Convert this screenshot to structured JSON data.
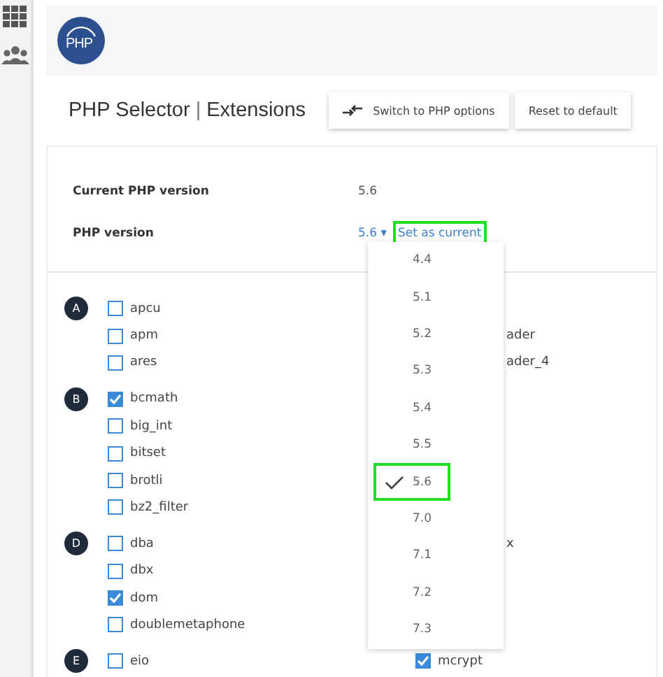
{
  "logo": {
    "text": "PHP"
  },
  "title": {
    "main": "PHP Selector",
    "separator": "|",
    "section": "Extensions"
  },
  "buttons": [
    {
      "label": "Switch to PHP options",
      "icon": true
    },
    {
      "label": "Reset to default",
      "icon": false
    }
  ],
  "current_version": {
    "label": "Current PHP version",
    "value": "5.6"
  },
  "php_version": {
    "label": "PHP version",
    "value": "5.6",
    "caret": "▾",
    "link": "Set as current",
    "highlighted": true
  },
  "groups": [
    {
      "letter": "A",
      "rows": [
        {
          "left": {
            "name": "apcu",
            "checked": false
          }
        },
        {
          "left": {
            "name": "apm",
            "checked": false
          },
          "right": {
            "kind": "fragment",
            "text": "ader"
          }
        },
        {
          "left": {
            "name": "ares",
            "checked": false
          },
          "right": {
            "kind": "fragment",
            "text": "ader_4"
          }
        }
      ]
    },
    {
      "letter": "B",
      "rows": [
        {
          "left": {
            "name": "bcmath",
            "checked": true
          }
        },
        {
          "left": {
            "name": "big_int",
            "checked": false
          }
        },
        {
          "left": {
            "name": "bitset",
            "checked": false
          }
        },
        {
          "left": {
            "name": "brotli",
            "checked": false
          }
        },
        {
          "left": {
            "name": "bz2_filter",
            "checked": false
          }
        }
      ]
    },
    {
      "letter": "D",
      "rows": [
        {
          "left": {
            "name": "dba",
            "checked": false
          },
          "right": {
            "kind": "fragment",
            "text": "x"
          }
        },
        {
          "left": {
            "name": "dbx",
            "checked": false
          }
        },
        {
          "left": {
            "name": "dom",
            "checked": true
          }
        },
        {
          "left": {
            "name": "doublemetaphone",
            "checked": false
          }
        }
      ]
    },
    {
      "letter": "E",
      "rows": [
        {
          "left": {
            "name": "eio",
            "checked": false
          },
          "right": {
            "kind": "checkbox",
            "name": "mcrypt",
            "checked": true
          }
        }
      ]
    }
  ],
  "version_menu": [
    {
      "label": "4.4",
      "selected": false,
      "highlighted": false
    },
    {
      "label": "5.1",
      "selected": false,
      "highlighted": false
    },
    {
      "label": "5.2",
      "selected": false,
      "highlighted": false
    },
    {
      "label": "5.3",
      "selected": false,
      "highlighted": false
    },
    {
      "label": "5.4",
      "selected": false,
      "highlighted": false
    },
    {
      "label": "5.5",
      "selected": false,
      "highlighted": false
    },
    {
      "label": "5.6",
      "selected": true,
      "highlighted": true
    },
    {
      "label": "7.0",
      "selected": false,
      "highlighted": false
    },
    {
      "label": "7.1",
      "selected": false,
      "highlighted": false
    },
    {
      "label": "7.2",
      "selected": false,
      "highlighted": false
    },
    {
      "label": "7.3",
      "selected": false,
      "highlighted": false
    }
  ]
}
